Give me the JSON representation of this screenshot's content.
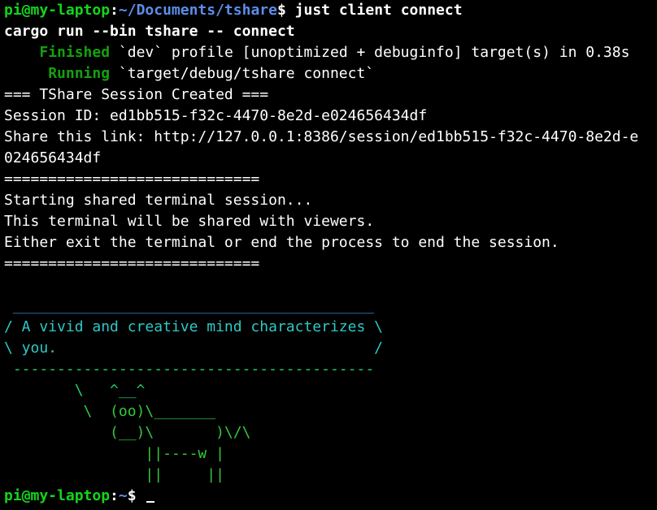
{
  "prompt": {
    "user_host": "pi@my-laptop",
    "colon": ":",
    "cwd": "~/Documents/tshare",
    "symbol": "$ ",
    "command": "just client connect"
  },
  "lines": {
    "cargo_cmd": "cargo run --bin tshare -- connect",
    "finished_pad": "    ",
    "finished_label": "Finished",
    "finished_text": " `dev` profile [unoptimized + debuginfo] target(s) in 0.38s",
    "running_pad": "     ",
    "running_label": "Running",
    "running_text": " `target/debug/tshare connect`",
    "session_created": "=== TShare Session Created ===",
    "session_id": "Session ID: ed1bb515-f32c-4470-8e2d-e024656434df",
    "share_link_1": "Share this link: http://127.0.0.1:8386/session/ed1bb515-f32c-4470-8e2d-e",
    "share_link_2": "024656434df",
    "separator_1": "=============================",
    "starting": "Starting shared terminal session...",
    "shared_with": "This terminal will be shared with viewers.",
    "either_exit": "Either exit the terminal or end the process to end the session.",
    "separator_2": "=============================",
    "blank_1": "",
    "blank_2": ""
  },
  "cowsay": {
    "top": " _________________________________________",
    "text_1": "/ A vivid and creative mind characterizes \\",
    "text_2": "\\ you.                                    /",
    "bottom": " -----------------------------------------",
    "cow_1": "        \\   ^__^",
    "cow_2": "         \\  (oo)\\_______",
    "cow_3": "            (__)\\       )\\/\\",
    "cow_4": "                ||----w |",
    "cow_5": "                ||     ||"
  },
  "final_prompt": {
    "user_host": "pi@my-laptop",
    "colon": ":",
    "cwd": "~",
    "symbol": "$ "
  },
  "colors": {
    "background": "#000000",
    "foreground": "#ffffff",
    "prompt_user": "#13d51b",
    "prompt_path": "#5c8de8",
    "cargo_status": "#13a10e"
  }
}
